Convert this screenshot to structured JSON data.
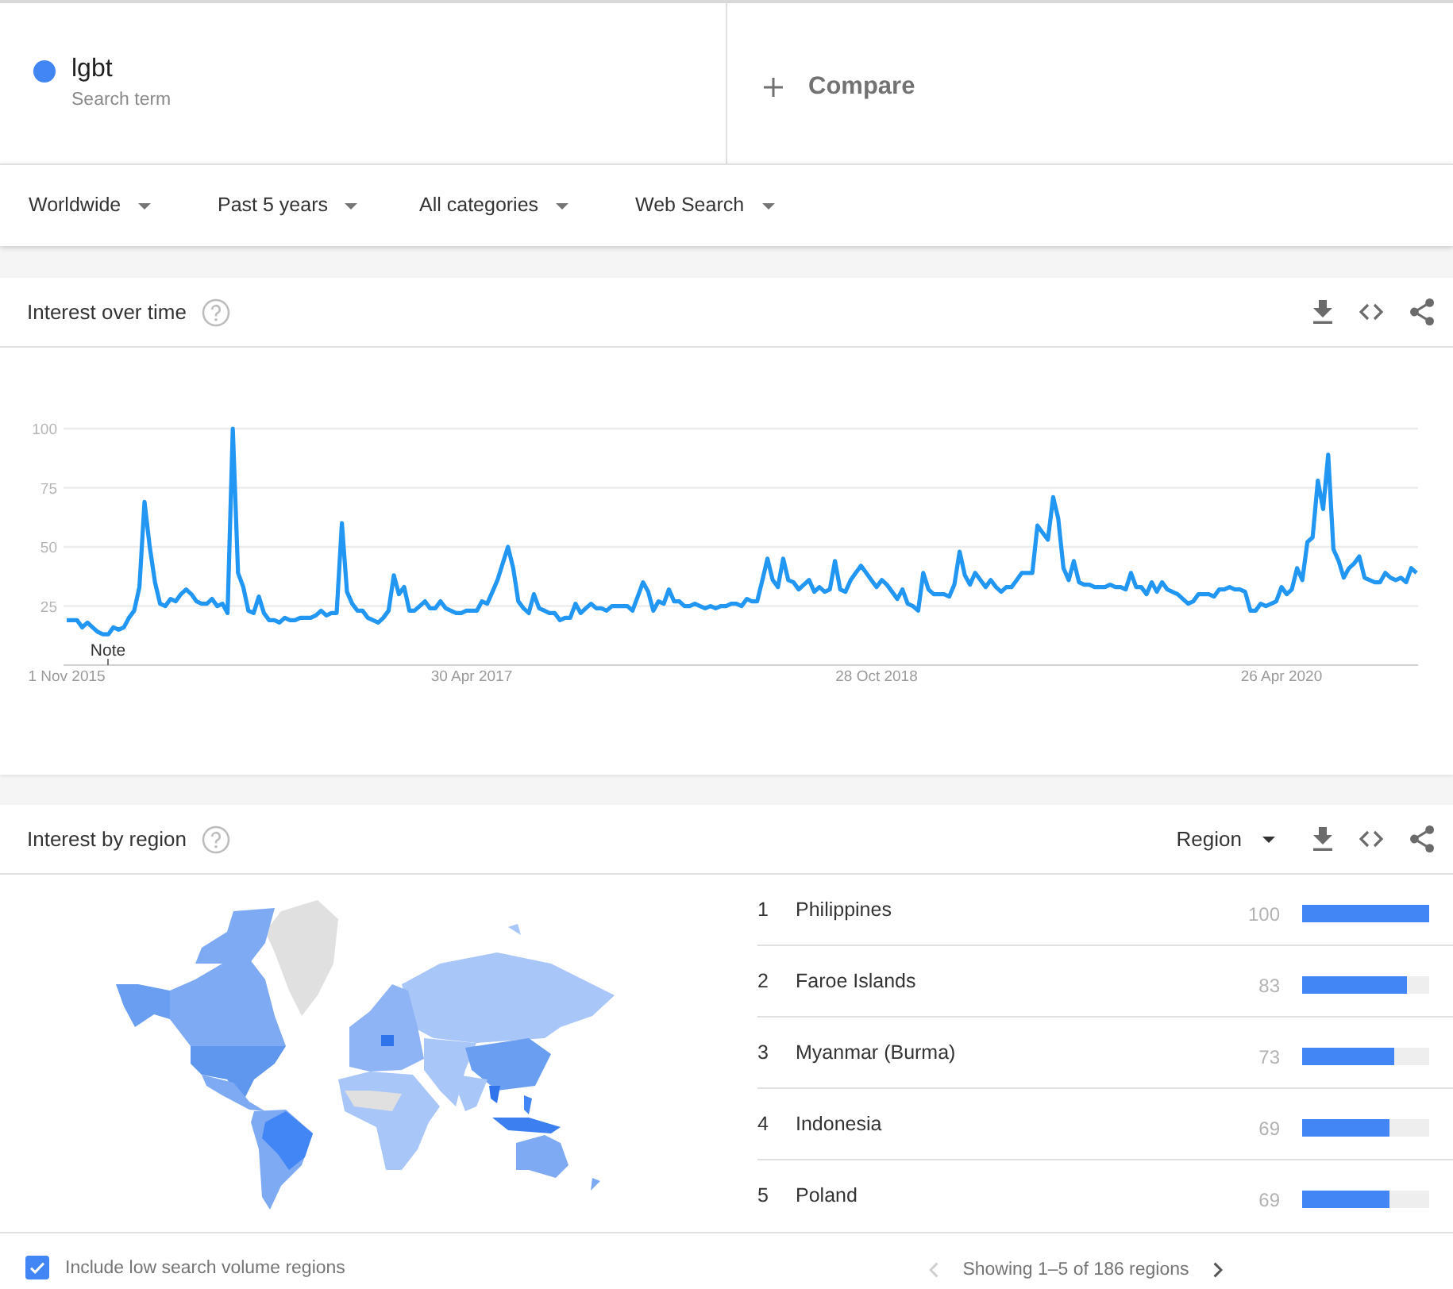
{
  "search_terms": [
    {
      "term": "lgbt",
      "label": "Search term",
      "color": "#4285f4"
    }
  ],
  "compare": {
    "label": "Compare"
  },
  "filters": [
    "Worldwide",
    "Past 5 years",
    "All categories",
    "Web Search"
  ],
  "interest_over_time": {
    "title": "Interest over time",
    "chart_data": {
      "type": "line",
      "grid": true,
      "categories": [
        "1 Nov 2015",
        null,
        null,
        null,
        null,
        null,
        null,
        null,
        null,
        null,
        null,
        null,
        null,
        null,
        null,
        null,
        null,
        null,
        null,
        null,
        null,
        null,
        null,
        null,
        null,
        null,
        null,
        null,
        null,
        null,
        null,
        null,
        null,
        null,
        null,
        null,
        null,
        null,
        null,
        null,
        null,
        null,
        null,
        null,
        null,
        null,
        null,
        null,
        null,
        null,
        null,
        null,
        null,
        null,
        null,
        null,
        null,
        null,
        null,
        null,
        null,
        null,
        null,
        null,
        null,
        null,
        null,
        null,
        null,
        null,
        null,
        null,
        null,
        null,
        null,
        null,
        null,
        null,
        "30 Apr 2017",
        null,
        null,
        null,
        null,
        null,
        null,
        null,
        null,
        null,
        null,
        null,
        null,
        null,
        null,
        null,
        null,
        null,
        null,
        null,
        null,
        null,
        null,
        null,
        null,
        null,
        null,
        null,
        null,
        null,
        null,
        null,
        null,
        null,
        null,
        null,
        null,
        null,
        null,
        null,
        null,
        null,
        null,
        null,
        null,
        null,
        null,
        null,
        null,
        null,
        null,
        null,
        null,
        null,
        null,
        null,
        null,
        null,
        null,
        null,
        null,
        null,
        null,
        null,
        null,
        null,
        null,
        null,
        null,
        null,
        null,
        null,
        null,
        null,
        null,
        null,
        null,
        null,
        "28 Oct 2018",
        null,
        null,
        null,
        null,
        null,
        null,
        null,
        null,
        null,
        null,
        null,
        null,
        null,
        null,
        null,
        null,
        null,
        null,
        null,
        null,
        null,
        null,
        null,
        null,
        null,
        null,
        null,
        null,
        null,
        null,
        null,
        null,
        null,
        null,
        null,
        null,
        null,
        null,
        null,
        null,
        null,
        null,
        null,
        null,
        null,
        null,
        null,
        null,
        null,
        null,
        null,
        null,
        null,
        null,
        null,
        null,
        null,
        null,
        null,
        null,
        null,
        null,
        null,
        null,
        null,
        null,
        null,
        null,
        null,
        null,
        null,
        null,
        null,
        null,
        null,
        null,
        null,
        "26 Apr 2020",
        null,
        null,
        null,
        null,
        null,
        null,
        null,
        null,
        null,
        null,
        null,
        null,
        null,
        null,
        null,
        null,
        null,
        null,
        null,
        null,
        null,
        null,
        null,
        null,
        null,
        null
      ],
      "series": [
        {
          "color": "#2196f3",
          "values": [
            19,
            19,
            19,
            16,
            18,
            16,
            14,
            13,
            13,
            16,
            15,
            16,
            20,
            23,
            33,
            69,
            50,
            35,
            26,
            25,
            28,
            27,
            30,
            32,
            30,
            27,
            26,
            26,
            28,
            25,
            26,
            22,
            100,
            39,
            33,
            23,
            22,
            29,
            22,
            19,
            19,
            18,
            20,
            19,
            19,
            20,
            20,
            20,
            21,
            23,
            21,
            22,
            22,
            60,
            31,
            26,
            23,
            23,
            20,
            19,
            18,
            20,
            23,
            38,
            30,
            33,
            23,
            23,
            25,
            27,
            24,
            24,
            27,
            24,
            23,
            22,
            22,
            23,
            23,
            23,
            27,
            26,
            31,
            36,
            43,
            50,
            41,
            27,
            24,
            22,
            30,
            24,
            23,
            22,
            22,
            19,
            20,
            20,
            26,
            22,
            24,
            26,
            24,
            24,
            23,
            25,
            25,
            25,
            25,
            23,
            29,
            35,
            31,
            23,
            27,
            26,
            32,
            27,
            27,
            25,
            25,
            26,
            25,
            24,
            25,
            24,
            25,
            25,
            26,
            26,
            25,
            28,
            27,
            27,
            36,
            45,
            36,
            33,
            45,
            36,
            35,
            32,
            34,
            36,
            31,
            33,
            31,
            32,
            44,
            32,
            31,
            36,
            39,
            42,
            39,
            36,
            33,
            36,
            34,
            31,
            28,
            32,
            26,
            25,
            23,
            39,
            32,
            30,
            30,
            30,
            29,
            34,
            48,
            38,
            34,
            39,
            36,
            33,
            36,
            33,
            31,
            33,
            33,
            36,
            39,
            39,
            39,
            59,
            56,
            53,
            71,
            62,
            41,
            36,
            44,
            35,
            34,
            34,
            33,
            33,
            33,
            34,
            33,
            33,
            32,
            39,
            33,
            33,
            30,
            35,
            31,
            35,
            32,
            31,
            30,
            28,
            26,
            27,
            30,
            30,
            30,
            29,
            32,
            32,
            33,
            32,
            32,
            31,
            23,
            23,
            26,
            25,
            26,
            27,
            33,
            30,
            32,
            41,
            36,
            52,
            54,
            78,
            66,
            89,
            49,
            44,
            37,
            41,
            43,
            46,
            37,
            36,
            35,
            35,
            39,
            37,
            36,
            37,
            35,
            41,
            39
          ]
        }
      ],
      "ylim": [
        0,
        100
      ],
      "yticks": [
        25,
        50,
        75,
        100
      ],
      "annotations": [
        "Note"
      ]
    }
  },
  "interest_by_region": {
    "title": "Interest by region",
    "resolution": "Region",
    "regions": [
      {
        "rank": "1",
        "name": "Philippines",
        "value": "100",
        "level": 1
      },
      {
        "rank": "2",
        "name": "Faroe Islands",
        "value": "83",
        "level": 0.83
      },
      {
        "rank": "3",
        "name": "Myanmar (Burma)",
        "value": "73",
        "level": 0.73
      },
      {
        "rank": "4",
        "name": "Indonesia",
        "value": "69",
        "level": 0.69
      },
      {
        "rank": "5",
        "name": "Poland",
        "value": "69",
        "level": 0.69
      }
    ],
    "include_low_volume": {
      "label": "Include low search volume regions",
      "checked": true
    },
    "pagination": {
      "text": "Showing 1–5 of 186 regions",
      "previous": {
        "disabled": true
      },
      "next": {
        "disabled": false
      }
    }
  }
}
